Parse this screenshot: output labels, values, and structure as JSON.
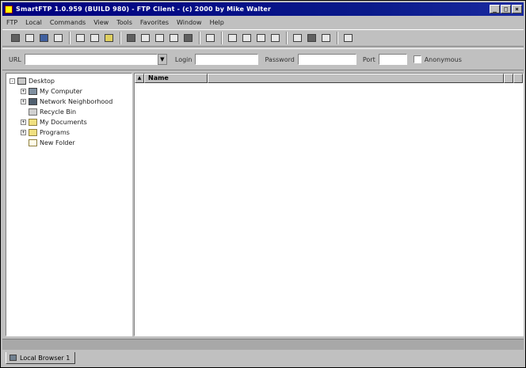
{
  "window": {
    "title": "SmartFTP 1.0.959 (BUILD 980) - FTP Client - (c) 2000 by Mike Walter",
    "minimize": "_",
    "maximize": "□",
    "close": "×"
  },
  "menu": [
    "FTP",
    "Local",
    "Commands",
    "View",
    "Tools",
    "Favorites",
    "Window",
    "Help"
  ],
  "connection": {
    "address_label": "URL",
    "address_value": "",
    "login_label": "Login",
    "login_value": "",
    "password_label": "Password",
    "password_value": "",
    "port_label": "Port",
    "port_value": "",
    "anonymous_label": "Anonymous"
  },
  "tree": {
    "root": "Desktop",
    "items": [
      {
        "label": "My Computer",
        "expander": "+",
        "icon": "computer-icon"
      },
      {
        "label": "Network Neighborhood",
        "expander": "+",
        "icon": "network-icon"
      },
      {
        "label": "Recycle Bin",
        "expander": "",
        "icon": "recycle-bin-icon"
      },
      {
        "label": "My Documents",
        "expander": "+",
        "icon": "folder-icon"
      },
      {
        "label": "Programs",
        "expander": "+",
        "icon": "folder-icon"
      },
      {
        "label": "New Folder",
        "expander": "",
        "icon": "folder-icon"
      }
    ]
  },
  "file_list": {
    "columns": [
      "Name"
    ]
  },
  "bottom": {
    "tab_label": "Local Browser 1"
  },
  "colors": {
    "titlebar": "#000080",
    "chrome": "#c0c0c0"
  }
}
